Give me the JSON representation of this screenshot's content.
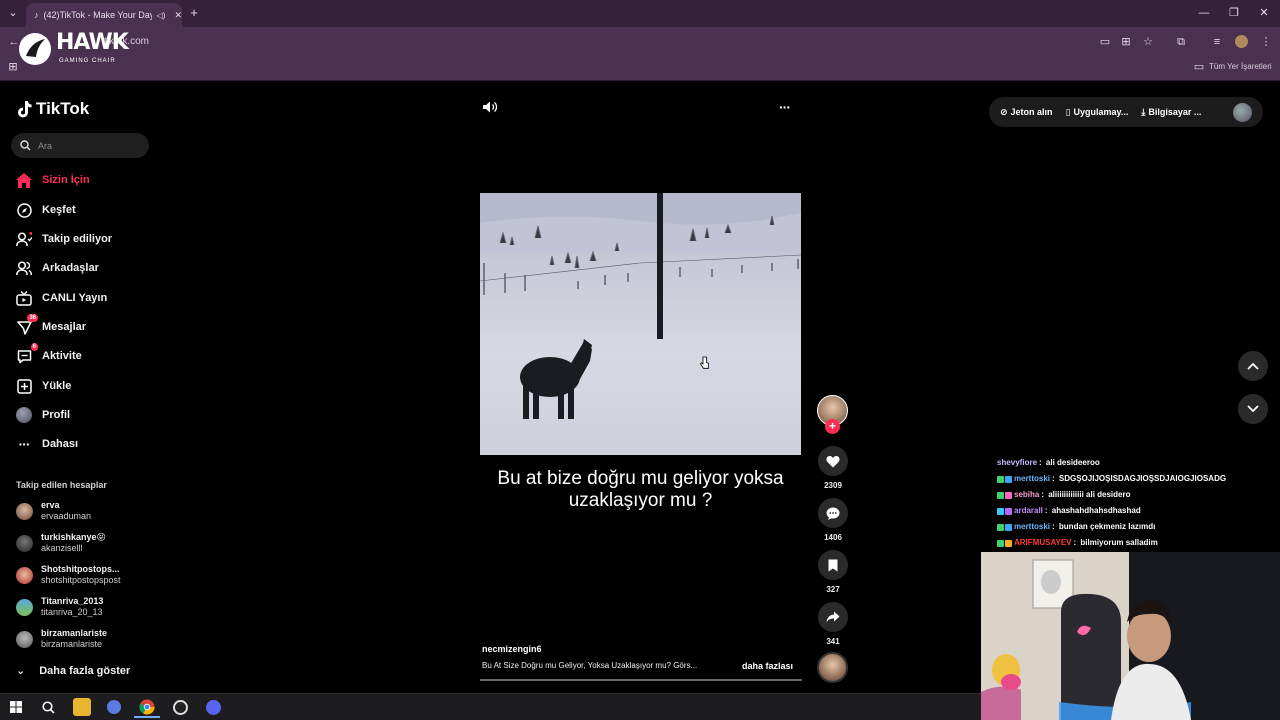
{
  "browser": {
    "tab_title": "(42)TikTok - Make Your Day",
    "url": "tiktok.com",
    "bookmarks_label": "Tüm Yer İşaretleri",
    "overlay_logo": {
      "title": "HAWK",
      "subtitle": "GAMING CHAIR"
    }
  },
  "brand": {
    "name": "TikTok",
    "accent": "#fe2c55"
  },
  "search": {
    "placeholder": "Ara"
  },
  "sidebar": {
    "items": [
      {
        "label": "Sizin İçin",
        "icon": "home-icon",
        "active": true
      },
      {
        "label": "Keşfet",
        "icon": "compass-icon"
      },
      {
        "label": "Takip ediliyor",
        "icon": "following-icon"
      },
      {
        "label": "Arkadaşlar",
        "icon": "friends-icon"
      },
      {
        "label": "CANLI Yayın",
        "icon": "live-icon"
      },
      {
        "label": "Mesajlar",
        "icon": "messages-icon",
        "badge": "36"
      },
      {
        "label": "Aktivite",
        "icon": "activity-icon",
        "badge": "6"
      },
      {
        "label": "Yükle",
        "icon": "upload-icon"
      },
      {
        "label": "Profil",
        "icon": "profile-avatar"
      },
      {
        "label": "Dahası",
        "icon": "more-icon"
      }
    ],
    "following_header": "Takip edilen hesaplar",
    "accounts": [
      {
        "name": "erva",
        "handle": "ervaaduman"
      },
      {
        "name": "turkishkanye😝",
        "handle": "akanziselll"
      },
      {
        "name": "Shotshitpostops...",
        "handle": "shotshitpostopspost"
      },
      {
        "name": "Titanriva_2013",
        "handle": "titanriva_20_13"
      },
      {
        "name": "birzamanlariste",
        "handle": "birzamanlariste"
      }
    ],
    "show_more": "Daha fazla göster"
  },
  "top_actions": {
    "coins": "Jeton alın",
    "app": "Uygulamay...",
    "desktop": "Bilgisayar ..."
  },
  "video": {
    "caption": "Bu at bize  doğru mu geliyor yoksa uzaklaşıyor mu ?",
    "author": "necmizengin6",
    "description": "Bu At Size Doğru mu Geliyor, Yoksa Uzaklaşıyor mu? Görs...",
    "more": "daha fazlası",
    "likes": "2309",
    "comments": "1406",
    "saves": "327",
    "shares": "341"
  },
  "chat": [
    {
      "user": "shevyfiore",
      "msg": "ali desideeroo",
      "color": "#c8b8ff"
    },
    {
      "user": "merttoski",
      "msg": "SDGŞOJIJOŞISDAGJIOŞSDJAIOGJIOSADG",
      "color": "#6ab7ff"
    },
    {
      "user": "sebiha",
      "msg": "aliiiiiiiiiiiii ali desidero",
      "color": "#ff9ad8"
    },
    {
      "user": "ardarall",
      "msg": "ahashahdhahsdhashad",
      "color": "#c48cff"
    },
    {
      "user": "merttoski",
      "msg": "bundan çekmeniz lazımdı",
      "color": "#6ab7ff"
    },
    {
      "user": "ARIFMUSAYEV",
      "msg": "bilmiyorum salladim",
      "color": "#ff3b3b"
    }
  ]
}
